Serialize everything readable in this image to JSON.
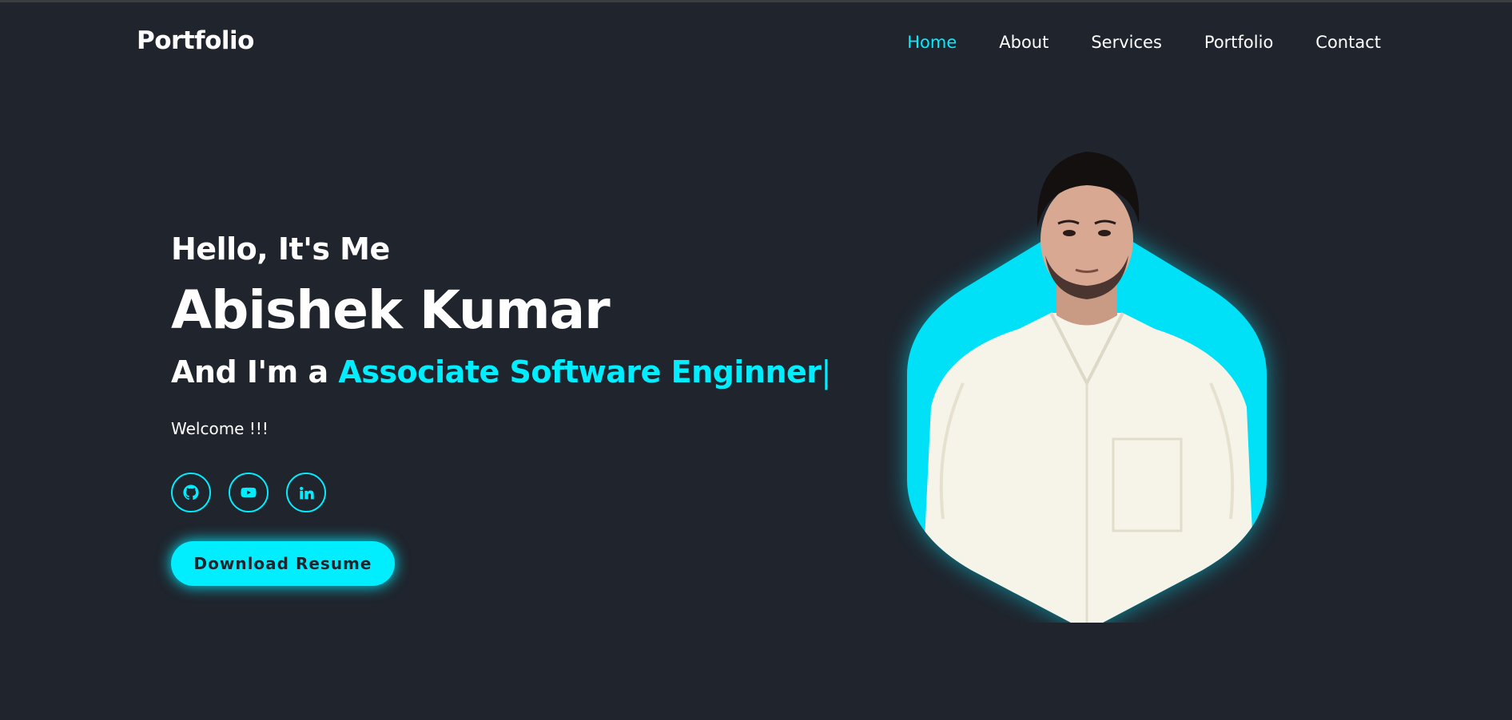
{
  "header": {
    "logo": "Portfolio",
    "nav": [
      {
        "label": "Home",
        "active": true
      },
      {
        "label": "About",
        "active": false
      },
      {
        "label": "Services",
        "active": false
      },
      {
        "label": "Portfolio",
        "active": false
      },
      {
        "label": "Contact",
        "active": false
      }
    ]
  },
  "hero": {
    "greeting": "Hello, It's Me",
    "name": "Abishek Kumar",
    "role_prefix": "And I'm a ",
    "role_highlight": "Associate Software Enginner",
    "role_cursor": "|",
    "welcome": "Welcome !!!",
    "social": [
      {
        "icon": "github-icon"
      },
      {
        "icon": "youtube-icon"
      },
      {
        "icon": "linkedin-icon"
      }
    ],
    "button_label": "Download Resume"
  },
  "colors": {
    "background": "#1f242d",
    "accent": "#00eeff",
    "text": "#ffffff"
  }
}
